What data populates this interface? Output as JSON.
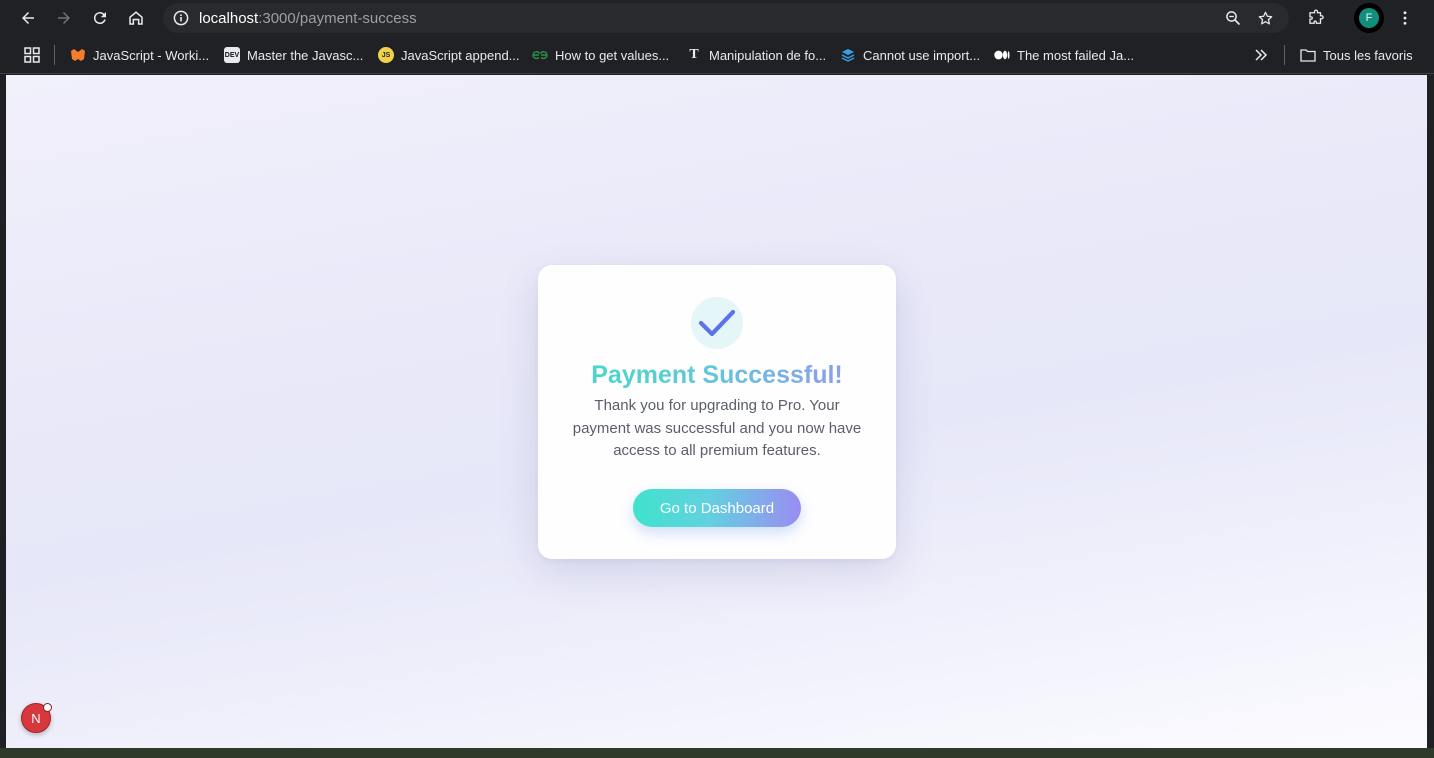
{
  "browser": {
    "url_host": "localhost",
    "url_path": ":3000/payment-success",
    "profile_initial": "F",
    "colors": {
      "toolbar": "#202124",
      "omnibox": "#282a2d",
      "avatar": "#0f8f7c"
    }
  },
  "bookmarks": {
    "items": [
      {
        "label": "JavaScript - Worki...",
        "icon": "mdn-icon"
      },
      {
        "label": "Master the Javasc...",
        "icon": "dev-icon",
        "icon_text": "DEV"
      },
      {
        "label": "JavaScript append...",
        "icon": "js-icon",
        "icon_text": "JS"
      },
      {
        "label": "How to get values...",
        "icon": "gfg-icon"
      },
      {
        "label": "Manipulation de fo...",
        "icon": "t-icon",
        "icon_text": "T"
      },
      {
        "label": "Cannot use import...",
        "icon": "layers-icon"
      },
      {
        "label": "The most failed Ja...",
        "icon": "medium-icon"
      }
    ],
    "all_bookmarks_label": "Tous les favoris"
  },
  "page": {
    "title": "Payment Successful!",
    "description": "Thank you for upgrading to Pro. Your payment was successful and you now have access to all premium features.",
    "button_label": "Go to Dashboard",
    "colors": {
      "gradient_start": "#3ddcc3",
      "gradient_end": "#9c8ff2",
      "check": "#5b73e8"
    }
  },
  "dev_indicator": {
    "label": "N"
  }
}
